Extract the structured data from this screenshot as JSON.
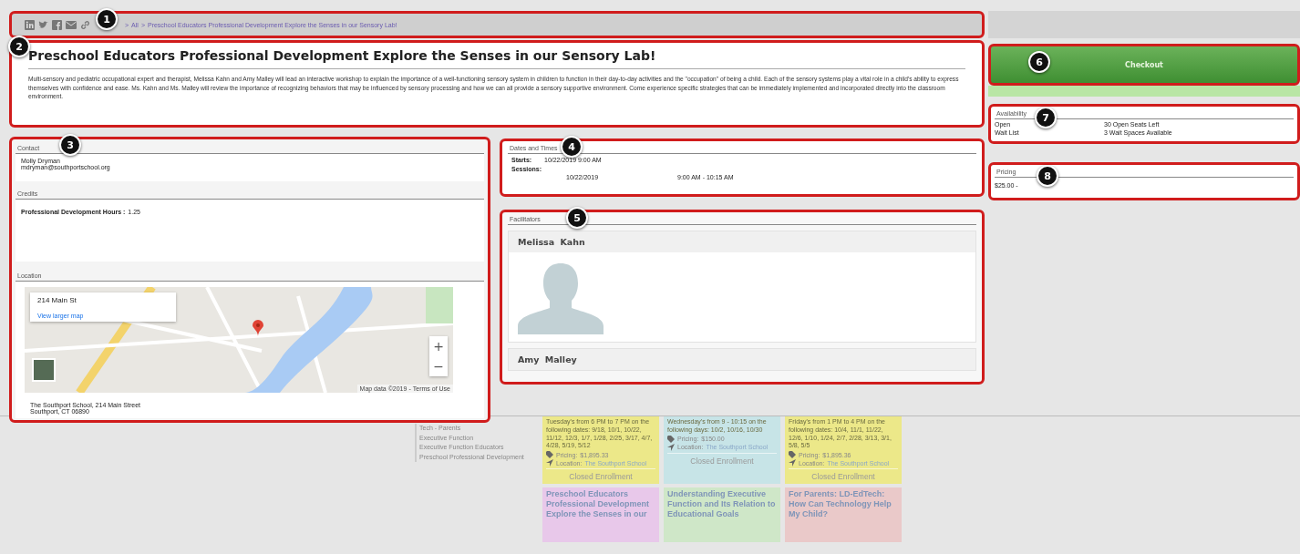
{
  "breadcrumb": {
    "callout": "1",
    "separator": ">",
    "crumbs": [
      "All",
      "Preschool Educators Professional Development Explore the Senses in our Sensory Lab!"
    ]
  },
  "description": {
    "callout": "2",
    "title": "Preschool Educators Professional Development Explore the Senses in our Sensory Lab!",
    "body": "Multi-sensory and pediatric occupational expert and therapist, Melissa Kahn and Amy Malley will lead an interactive workshop to explain the importance of a well-functioning sensory system in children to function in their day-to-day activities and the \"occupation\" of being a child. Each of the sensory systems play a vital role in a child's ability to express themselves with confidence and ease. Ms. Kahn and Ms. Malley will review the importance of recognizing behaviors that may be influenced by sensory processing and how we can all provide a sensory supportive environment. Come experience specific strategies that can be immediately implemented and incorporated directly into the classroom environment."
  },
  "contact": {
    "callout": "3",
    "heading": "Contact",
    "name": "Molly Dryman",
    "email": "mdryman@southportschool.org"
  },
  "credits": {
    "heading": "Credits",
    "label": "Professional Development Hours :",
    "value": "1.25"
  },
  "location": {
    "heading": "Location",
    "map": {
      "place": "214 Main St",
      "link": "View larger map",
      "attribution": "Map data ©2019",
      "separator": "-",
      "terms": "Terms of Use",
      "zoom_in": "+",
      "zoom_out": "−"
    },
    "address": [
      "The Southport School, 214 Main Street",
      "Southport, CT 06890"
    ]
  },
  "dates": {
    "callout": "4",
    "heading": "Dates and Times",
    "starts_label": "Starts:",
    "starts": "10/22/2019 9:00 AM",
    "sessions_label": "Sessions:",
    "sessions": [
      {
        "date": "10/22/2019",
        "time": "9:00 AM - 10:15 AM"
      }
    ]
  },
  "facilitators": {
    "callout": "5",
    "heading": "Facilitators",
    "people": [
      {
        "name": "Melissa Kahn",
        "photo": true
      },
      {
        "name": "Amy Malley",
        "photo": false
      }
    ]
  },
  "checkout": {
    "callout": "6",
    "label": "Checkout"
  },
  "availability": {
    "callout": "7",
    "heading": "Availability",
    "rows": [
      {
        "label": "Open",
        "value": "30 Open Seats Left"
      },
      {
        "label": "Wait List",
        "value": "3 Wait Spaces Available"
      }
    ]
  },
  "pricing": {
    "callout": "8",
    "heading": "Pricing",
    "value": "$25.00 -"
  },
  "background_page": {
    "categories": [
      "Tech - Parents",
      "Executive Function",
      "Executive Function Educators",
      "Preschool Professional Development"
    ],
    "cards": [
      {
        "color": "#ece889",
        "schedule": "Tuesday's from 6 PM to 7 PM on the following dates: 9/18, 10/1, 10/22, 11/12, 12/3, 1/7, 1/28, 2/25, 3/17, 4/7, 4/28, 5/19, 5/12",
        "pricing_label": "Pricing:",
        "pricing": "$1,895.33",
        "location_label": "Location:",
        "location": "The Southport School",
        "status": "Closed Enrollment"
      },
      {
        "color": "#c7e4e7",
        "schedule": "Wednesday's from 9 - 10:15 on the following days: 10/2, 10/16, 10/30",
        "pricing_label": "Pricing:",
        "pricing": "$150.00",
        "location_label": "Location:",
        "location": "The Southport School",
        "status": "Closed Enrollment"
      },
      {
        "color": "#ece889",
        "schedule": "Friday's from 1 PM to 4 PM on the following dates: 10/4, 11/1, 11/22, 12/6, 1/10, 1/24, 2/7, 2/28, 3/13, 3/1, 5/8, 5/5",
        "pricing_label": "Pricing:",
        "pricing": "$1,895.36",
        "location_label": "Location:",
        "location": "The Southport School",
        "status": "Closed Enrollment"
      }
    ],
    "next_cards": [
      {
        "color": "#e8c8ea",
        "title": "Preschool Educators Professional Development Explore the Senses in our"
      },
      {
        "color": "#cfe7c8",
        "title": "Understanding Executive Function and Its Relation to Educational Goals"
      },
      {
        "color": "#eac9c9",
        "title": "For Parents: LD-EdTech: How Can Technology Help My Child?"
      }
    ]
  }
}
